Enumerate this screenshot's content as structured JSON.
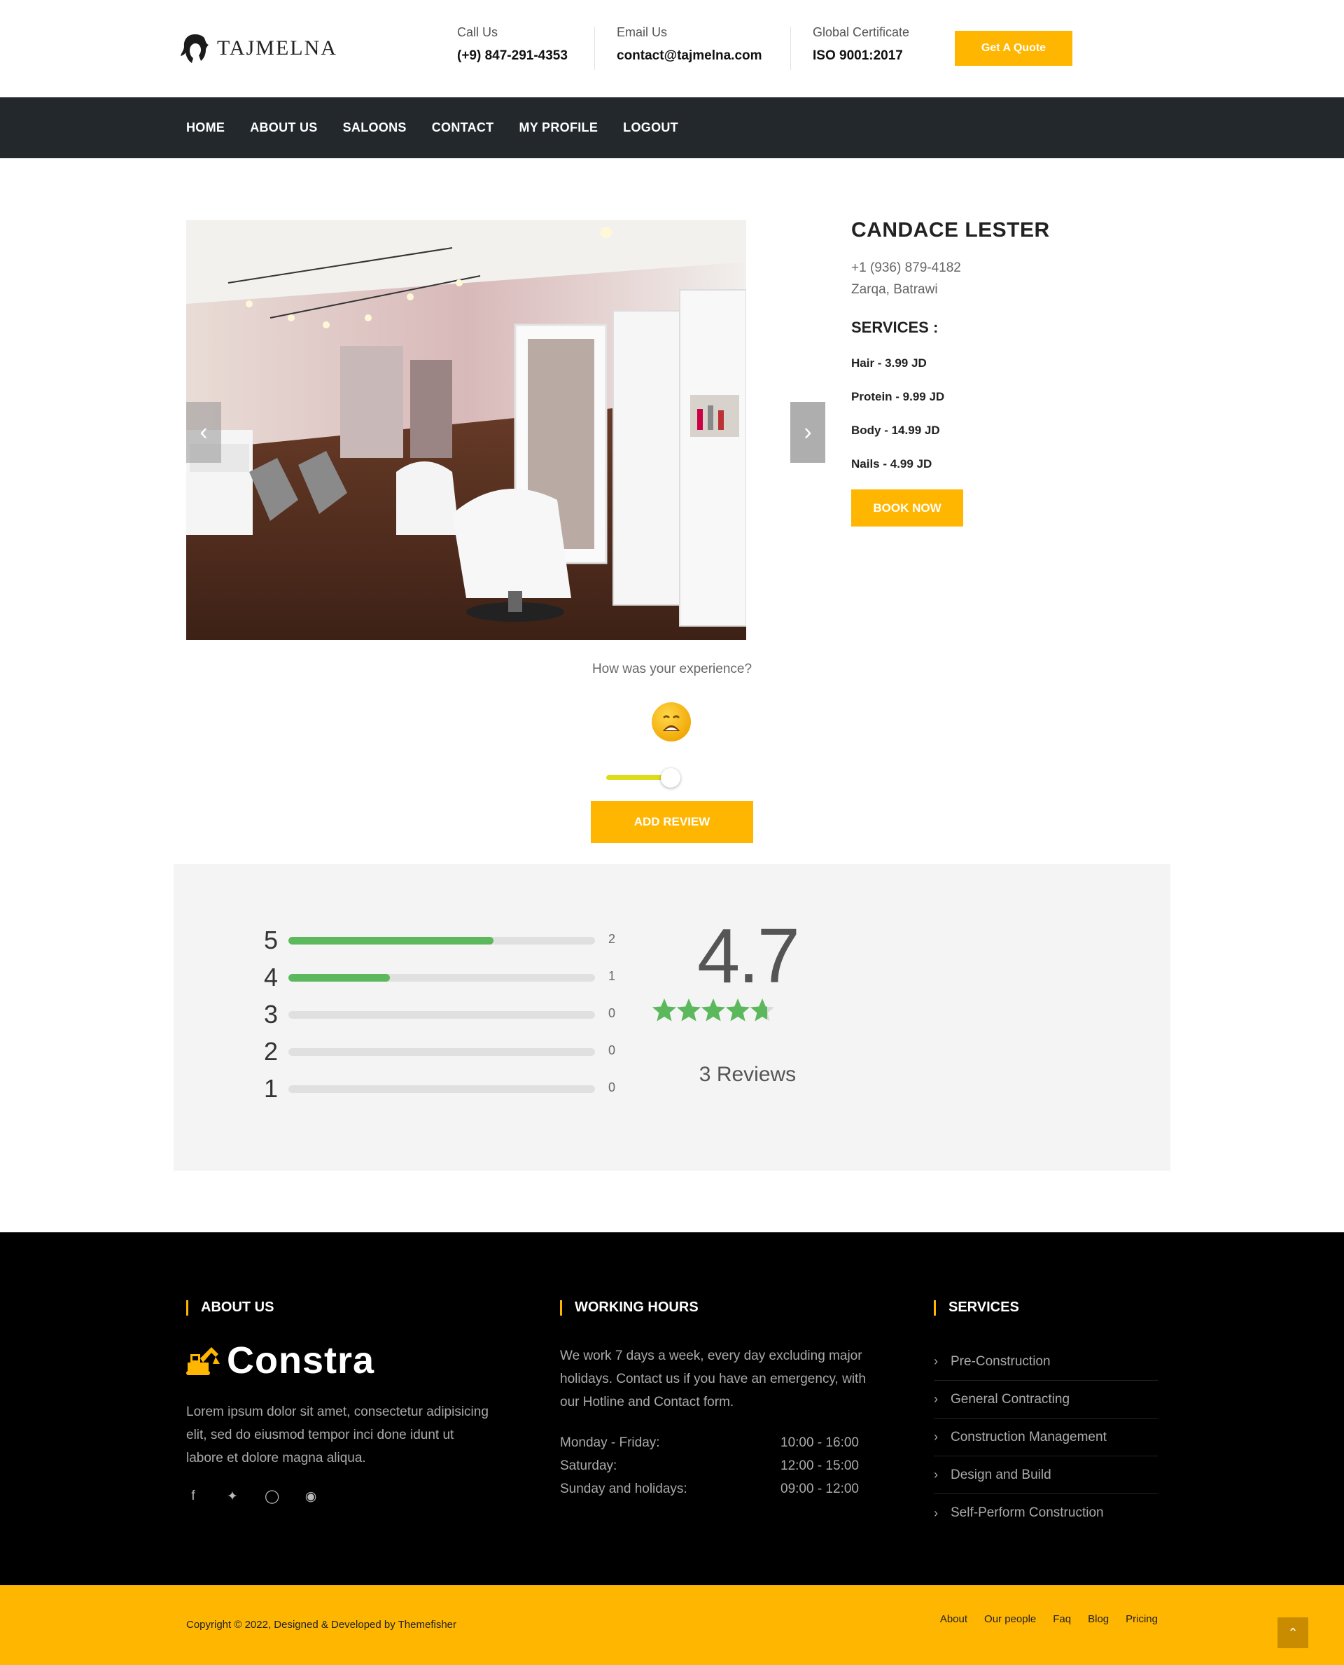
{
  "header": {
    "brand": "TAJMELNA",
    "call_label": "Call Us",
    "call_value": "(+9) 847-291-4353",
    "email_label": "Email Us",
    "email_value": "contact@tajmelna.com",
    "cert_label": "Global Certificate",
    "cert_value": "ISO 9001:2017",
    "quote_button": "Get A Quote"
  },
  "nav": {
    "items": [
      "HOME",
      "ABOUT US",
      "SALOONS",
      "CONTACT",
      "MY PROFILE",
      "LOGOUT"
    ]
  },
  "gallery": {
    "prev_icon": "chevron-left-icon",
    "next_icon": "chevron-right-icon"
  },
  "salon": {
    "name": "CANDACE LESTER",
    "phone": "+1 (936) 879-4182",
    "address": "Zarqa, Batrawi",
    "services_title": "SERVICES :",
    "services": [
      "Hair - 3.99 JD",
      "Protein - 9.99 JD",
      "Body - 14.99 JD",
      "Nails - 4.99 JD"
    ],
    "book_button": "BOOK NOW"
  },
  "review_form": {
    "question": "How was your experience?",
    "emoji_icon": "sad-face-icon",
    "slider_value": 0.67,
    "slider_color": "#dcdc1a",
    "submit_button": "ADD REVIEW"
  },
  "ratings": {
    "average": "4.7",
    "average_stars": 4.7,
    "reviews_label": "3 Reviews",
    "bar_color": "#5cb85c",
    "rows": [
      {
        "stars": "5",
        "count": "2",
        "fraction": 0.67
      },
      {
        "stars": "4",
        "count": "1",
        "fraction": 0.33
      },
      {
        "stars": "3",
        "count": "0",
        "fraction": 0
      },
      {
        "stars": "2",
        "count": "0",
        "fraction": 0
      },
      {
        "stars": "1",
        "count": "0",
        "fraction": 0
      }
    ]
  },
  "footer": {
    "about_title": "ABOUT US",
    "about_brand": "Constra",
    "about_text": "Lorem ipsum dolor sit amet, consectetur adipisicing elit, sed do eiusmod tempor inci done idunt ut labore et dolore magna aliqua.",
    "social_icons": [
      "facebook-icon",
      "twitter-icon",
      "instagram-icon",
      "github-icon"
    ],
    "hours_title": "WORKING HOURS",
    "hours_text": "We work 7 days a week, every day excluding major holidays. Contact us if you have an emergency, with our Hotline and Contact form.",
    "hours": [
      {
        "day": "Monday - Friday:",
        "time": "10:00 - 16:00"
      },
      {
        "day": "Saturday:",
        "time": "12:00 - 15:00"
      },
      {
        "day": "Sunday and holidays:",
        "time": "09:00 - 12:00"
      }
    ],
    "services_title": "SERVICES",
    "services": [
      "Pre-Construction",
      "General Contracting",
      "Construction Management",
      "Design and Build",
      "Self-Perform Construction"
    ],
    "copyright": "Copyright © 2022, Designed & Developed by Themefisher",
    "links": [
      "About",
      "Our people",
      "Faq",
      "Blog",
      "Pricing"
    ],
    "accent_color": "#ffb600"
  }
}
